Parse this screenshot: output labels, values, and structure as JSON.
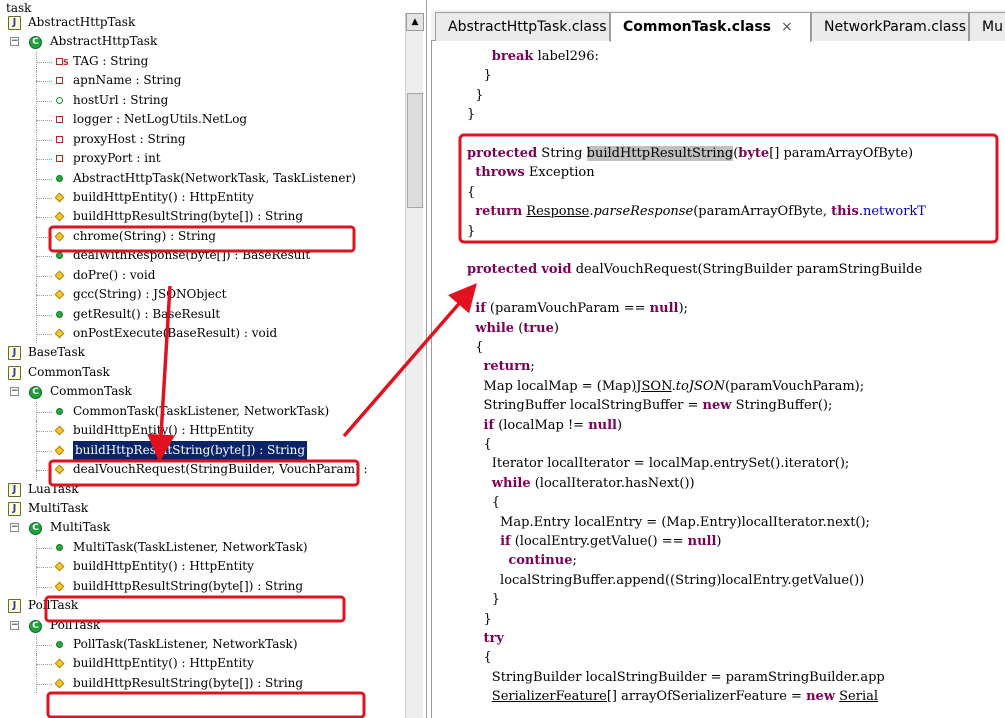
{
  "tree": {
    "root_label": "task",
    "rows": [
      {
        "label": "AbstractHttpTask",
        "kind": "java-file"
      },
      {
        "label": "AbstractHttpTask",
        "kind": "class"
      },
      {
        "label": "TAG : String",
        "kind": "private-static"
      },
      {
        "label": "apnName : String",
        "kind": "private"
      },
      {
        "label": "hostUrl : String",
        "kind": "package"
      },
      {
        "label": "logger : NetLogUtils.NetLog",
        "kind": "private"
      },
      {
        "label": "proxyHost : String",
        "kind": "private"
      },
      {
        "label": "proxyPort : int",
        "kind": "private"
      },
      {
        "label": "AbstractHttpTask(NetworkTask, TaskListener)",
        "kind": "public"
      },
      {
        "label": "buildHttpEntity() : HttpEntity",
        "kind": "protected"
      },
      {
        "label": "buildHttpResultString(byte[]) : String",
        "kind": "protected"
      },
      {
        "label": "chrome(String) : String",
        "kind": "protected"
      },
      {
        "label": "dealWithResponse(byte[]) : BaseResult",
        "kind": "public"
      },
      {
        "label": "doPre() : void",
        "kind": "protected"
      },
      {
        "label": "gcc(String) : JSONObject",
        "kind": "protected"
      },
      {
        "label": "getResult() : BaseResult",
        "kind": "public"
      },
      {
        "label": "onPostExecute(BaseResult) : void",
        "kind": "protected"
      },
      {
        "label": "BaseTask",
        "kind": "java-file"
      },
      {
        "label": "CommonTask",
        "kind": "java-file"
      },
      {
        "label": "CommonTask",
        "kind": "class"
      },
      {
        "label": "CommonTask(TaskListener, NetworkTask)",
        "kind": "public"
      },
      {
        "label": "buildHttpEntity() : HttpEntity",
        "kind": "protected"
      },
      {
        "label": "buildHttpResultString(byte[]) : String",
        "kind": "protected",
        "selected": true
      },
      {
        "label": "dealVouchRequest(StringBuilder, VouchParam) : ",
        "kind": "protected"
      },
      {
        "label": "LuaTask",
        "kind": "java-file"
      },
      {
        "label": "MultiTask",
        "kind": "java-file"
      },
      {
        "label": "MultiTask",
        "kind": "class"
      },
      {
        "label": "MultiTask(TaskListener, NetworkTask)",
        "kind": "public"
      },
      {
        "label": "buildHttpEntity() : HttpEntity",
        "kind": "protected"
      },
      {
        "label": "buildHttpResultString(byte[]) : String",
        "kind": "protected"
      },
      {
        "label": "PollTask",
        "kind": "java-file"
      },
      {
        "label": "PollTask",
        "kind": "class"
      },
      {
        "label": "PollTask(TaskListener, NetworkTask)",
        "kind": "public"
      },
      {
        "label": "buildHttpEntity() : HttpEntity",
        "kind": "protected"
      },
      {
        "label": "buildHttpResultString(byte[]) : String",
        "kind": "protected"
      }
    ]
  },
  "tabs": [
    {
      "label": "AbstractHttpTask.class",
      "active": false
    },
    {
      "label": "CommonTask.class",
      "active": true,
      "close": "×"
    },
    {
      "label": "NetworkParam.class",
      "active": false
    },
    {
      "label": "Mu",
      "active": false
    }
  ],
  "code_lines": [
    [
      [
        "      ",
        ""
      ],
      [
        "break",
        "kw"
      ],
      [
        " label296:",
        ""
      ]
    ],
    [
      [
        "    }",
        ""
      ]
    ],
    [
      [
        "  }",
        ""
      ]
    ],
    [
      [
        "}",
        ""
      ]
    ],
    [
      [
        "",
        ""
      ]
    ],
    [
      [
        "protected",
        "kw"
      ],
      [
        " String ",
        ""
      ],
      [
        "buildHttpResultString",
        "hl"
      ],
      [
        "(",
        ""
      ],
      [
        "byte",
        "kw"
      ],
      [
        "[] paramArrayOfByte)",
        ""
      ]
    ],
    [
      [
        "  ",
        ""
      ],
      [
        "throws",
        "kw"
      ],
      [
        " Exception",
        ""
      ]
    ],
    [
      [
        "{",
        ""
      ]
    ],
    [
      [
        "  ",
        ""
      ],
      [
        "return",
        "kw"
      ],
      [
        " ",
        ""
      ],
      [
        "Response",
        "ul"
      ],
      [
        ".",
        ""
      ],
      [
        "parseResponse",
        "it"
      ],
      [
        "(paramArrayOfByte, ",
        ""
      ],
      [
        "this",
        "kw"
      ],
      [
        ".",
        ""
      ],
      [
        "networkT",
        "fld"
      ]
    ],
    [
      [
        "}",
        ""
      ]
    ],
    [
      [
        "",
        ""
      ]
    ],
    [
      [
        "protected",
        "kw"
      ],
      [
        " ",
        ""
      ],
      [
        "void",
        "kw"
      ],
      [
        " dealVouchRequest(StringBuilder paramStringBuilde",
        ""
      ]
    ],
    [
      [
        "",
        ""
      ]
    ],
    [
      [
        "  ",
        ""
      ],
      [
        "if",
        "kw"
      ],
      [
        " (paramVouchParam == ",
        ""
      ],
      [
        "null",
        "kw"
      ],
      [
        ");",
        ""
      ]
    ],
    [
      [
        "  ",
        ""
      ],
      [
        "while",
        "kw"
      ],
      [
        " (",
        ""
      ],
      [
        "true",
        "kw"
      ],
      [
        ")",
        ""
      ]
    ],
    [
      [
        "  {",
        ""
      ]
    ],
    [
      [
        "    ",
        ""
      ],
      [
        "return",
        "kw"
      ],
      [
        ";",
        ""
      ]
    ],
    [
      [
        "    Map localMap = (Map)",
        ""
      ],
      [
        "JSON",
        "ul"
      ],
      [
        ".",
        ""
      ],
      [
        "toJSON",
        "it"
      ],
      [
        "(paramVouchParam);",
        ""
      ]
    ],
    [
      [
        "    StringBuffer localStringBuffer = ",
        ""
      ],
      [
        "new",
        "kw"
      ],
      [
        " StringBuffer();",
        ""
      ]
    ],
    [
      [
        "    ",
        ""
      ],
      [
        "if",
        "kw"
      ],
      [
        " (localMap != ",
        ""
      ],
      [
        "null",
        "kw"
      ],
      [
        ")",
        ""
      ]
    ],
    [
      [
        "    {",
        ""
      ]
    ],
    [
      [
        "      Iterator localIterator = localMap.entrySet().iterator();",
        ""
      ]
    ],
    [
      [
        "      ",
        ""
      ],
      [
        "while",
        "kw"
      ],
      [
        " (localIterator.hasNext())",
        ""
      ]
    ],
    [
      [
        "      {",
        ""
      ]
    ],
    [
      [
        "        Map.Entry localEntry = (Map.Entry)localIterator.next();",
        ""
      ]
    ],
    [
      [
        "        ",
        ""
      ],
      [
        "if",
        "kw"
      ],
      [
        " (localEntry.getValue() == ",
        ""
      ],
      [
        "null",
        "kw"
      ],
      [
        ")",
        ""
      ]
    ],
    [
      [
        "          ",
        ""
      ],
      [
        "continue",
        "kw"
      ],
      [
        ";",
        ""
      ]
    ],
    [
      [
        "        localStringBuffer.append((String)localEntry.getValue())",
        ""
      ]
    ],
    [
      [
        "      }",
        ""
      ]
    ],
    [
      [
        "    }",
        ""
      ]
    ],
    [
      [
        "    ",
        ""
      ],
      [
        "try",
        "kw"
      ]
    ],
    [
      [
        "    {",
        ""
      ]
    ],
    [
      [
        "      StringBuilder localStringBuilder = paramStringBuilder.app",
        ""
      ]
    ],
    [
      [
        "      ",
        ""
      ],
      [
        "SerializerFeature",
        "ul"
      ],
      [
        "[] arrayOfSerializerFeature = ",
        ""
      ],
      [
        "new",
        "kw"
      ],
      [
        " ",
        ""
      ],
      [
        "Serial",
        "ul"
      ]
    ]
  ],
  "colors": {
    "annotation": "#e0121f",
    "keyword": "#7f0055",
    "selection": "#0a246a",
    "field": "#0000c0"
  }
}
